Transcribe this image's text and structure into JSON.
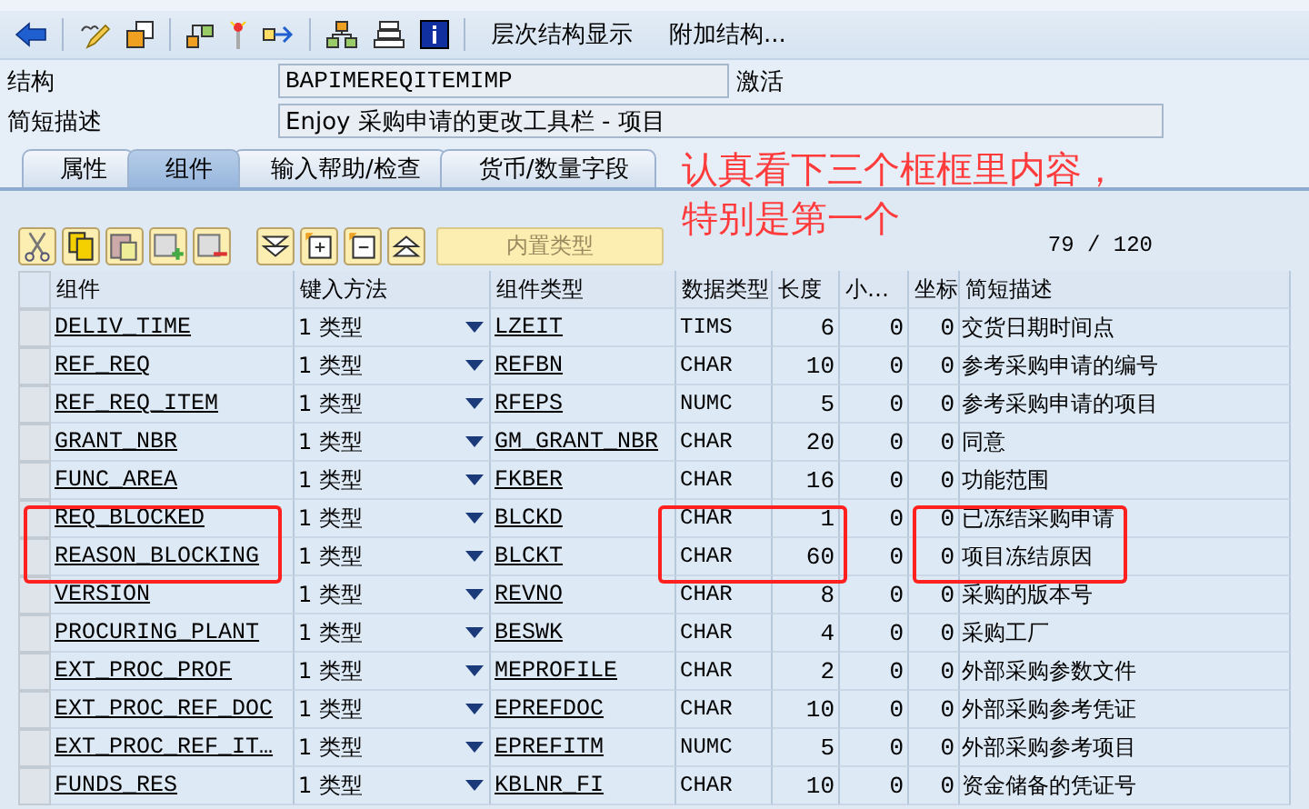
{
  "toolbar": {
    "buttons": [
      "层次结构显示",
      "附加结构..."
    ]
  },
  "header": {
    "structure_label": "结构",
    "structure_value": "BAPIMEREQITEMIMP",
    "status": "激活",
    "description_label": "简短描述",
    "description_value": "Enjoy 采购申请的更改工具栏 - 项目"
  },
  "tabs": [
    {
      "label": "属性",
      "selected": false
    },
    {
      "label": "组件",
      "selected": true
    },
    {
      "label": "输入帮助/检查",
      "selected": false
    },
    {
      "label": "货币/数量字段",
      "selected": false
    }
  ],
  "annotation": {
    "lines": [
      "认真看下三个框框里内容，",
      "特别是第一个"
    ]
  },
  "table_toolbar": {
    "builtin_type_button": "内置类型",
    "counter": "79 / 120"
  },
  "table": {
    "columns": [
      "组件",
      "键入方法",
      "组件类型",
      "数据类型",
      "长度",
      "小…",
      "坐标",
      "简短描述"
    ],
    "rows": [
      {
        "component": "DELIV_TIME",
        "method": "1 类型",
        "type": "LZEIT",
        "data_type": "TIMS",
        "length": "6",
        "decimals": "0",
        "coordinate": "0",
        "description": "交货日期时间点",
        "highlighted": false
      },
      {
        "component": "REF_REQ",
        "method": "1 类型",
        "type": "REFBN",
        "data_type": "CHAR",
        "length": "10",
        "decimals": "0",
        "coordinate": "0",
        "description": "参考采购申请的编号",
        "highlighted": false
      },
      {
        "component": "REF_REQ_ITEM",
        "method": "1 类型",
        "type": "RFEPS",
        "data_type": "NUMC",
        "length": "5",
        "decimals": "0",
        "coordinate": "0",
        "description": "参考采购申请的项目",
        "highlighted": false
      },
      {
        "component": "GRANT_NBR",
        "method": "1 类型",
        "type": "GM_GRANT_NBR",
        "data_type": "CHAR",
        "length": "20",
        "decimals": "0",
        "coordinate": "0",
        "description": "同意",
        "highlighted": false
      },
      {
        "component": "FUNC_AREA",
        "method": "1 类型",
        "type": "FKBER",
        "data_type": "CHAR",
        "length": "16",
        "decimals": "0",
        "coordinate": "0",
        "description": "功能范围",
        "highlighted": false
      },
      {
        "component": "REQ_BLOCKED",
        "method": "1 类型",
        "type": "BLCKD",
        "data_type": "CHAR",
        "length": "1",
        "decimals": "0",
        "coordinate": "0",
        "description": "已冻结采购申请",
        "highlighted": true
      },
      {
        "component": "REASON_BLOCKING",
        "method": "1 类型",
        "type": "BLCKT",
        "data_type": "CHAR",
        "length": "60",
        "decimals": "0",
        "coordinate": "0",
        "description": "项目冻结原因",
        "highlighted": true
      },
      {
        "component": "VERSION",
        "method": "1 类型",
        "type": "REVNO",
        "data_type": "CHAR",
        "length": "8",
        "decimals": "0",
        "coordinate": "0",
        "description": "采购的版本号",
        "highlighted": false
      },
      {
        "component": "PROCURING_PLANT",
        "method": "1 类型",
        "type": "BESWK",
        "data_type": "CHAR",
        "length": "4",
        "decimals": "0",
        "coordinate": "0",
        "description": "采购工厂",
        "highlighted": false
      },
      {
        "component": "EXT_PROC_PROF",
        "method": "1 类型",
        "type": "MEPROFILE",
        "data_type": "CHAR",
        "length": "2",
        "decimals": "0",
        "coordinate": "0",
        "description": "外部采购参数文件",
        "highlighted": false
      },
      {
        "component": "EXT_PROC_REF_DOC",
        "method": "1 类型",
        "type": "EPREFDOC",
        "data_type": "CHAR",
        "length": "10",
        "decimals": "0",
        "coordinate": "0",
        "description": "外部采购参考凭证",
        "highlighted": false
      },
      {
        "component": "EXT_PROC_REF_IT…",
        "method": "1 类型",
        "type": "EPREFITM",
        "data_type": "NUMC",
        "length": "5",
        "decimals": "0",
        "coordinate": "0",
        "description": "外部采购参考项目",
        "highlighted": false
      },
      {
        "component": "FUNDS_RES",
        "method": "1 类型",
        "type": "KBLNR_FI",
        "data_type": "CHAR",
        "length": "10",
        "decimals": "0",
        "coordinate": "0",
        "description": "资金储备的凭证号",
        "highlighted": false
      }
    ]
  }
}
